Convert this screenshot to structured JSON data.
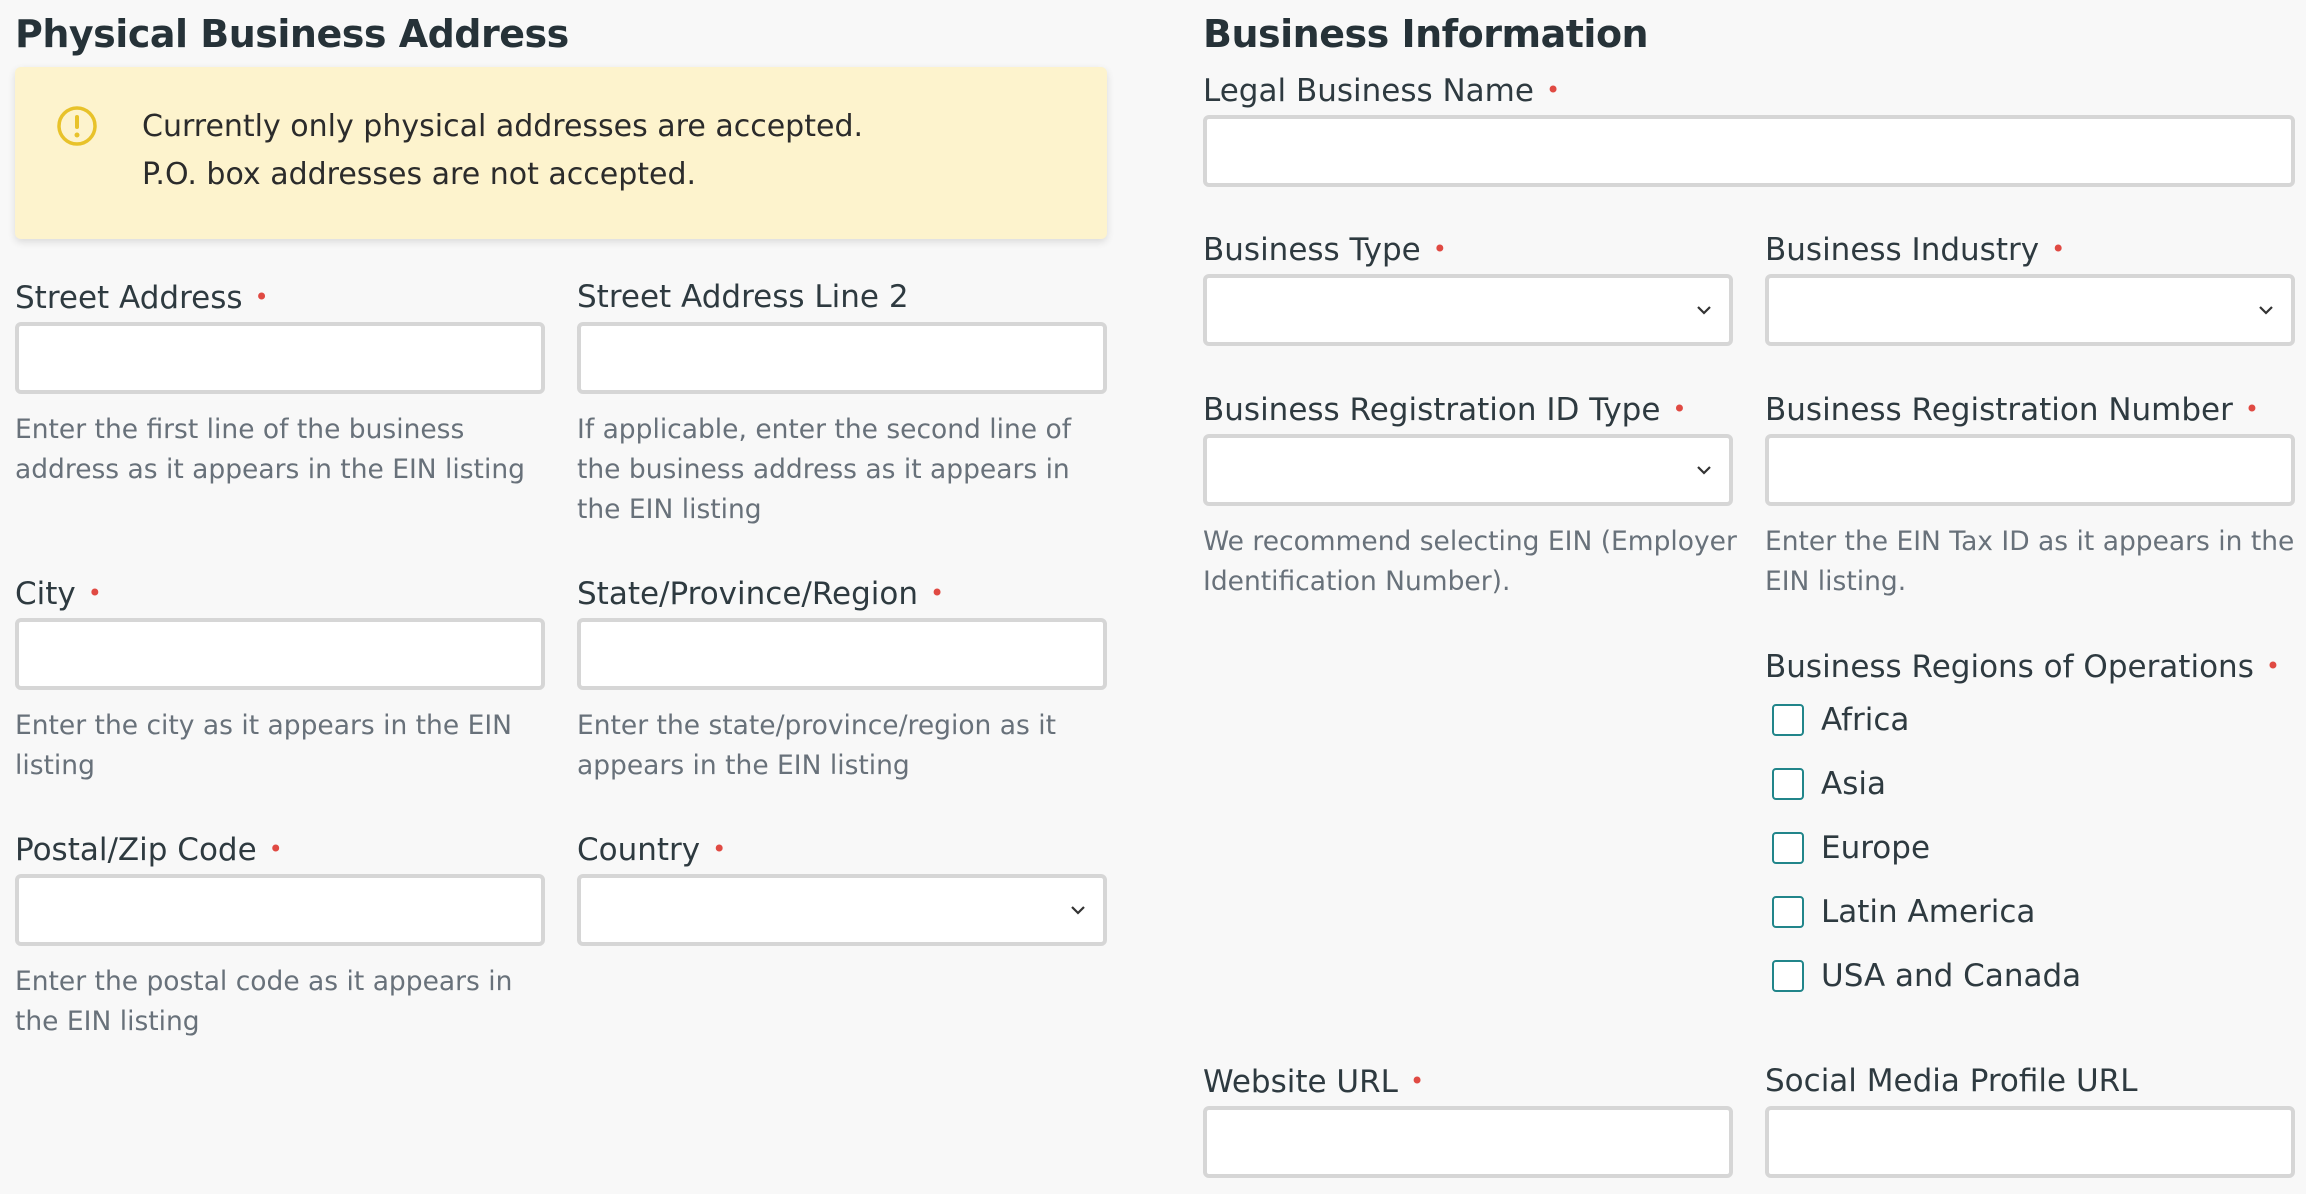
{
  "address": {
    "title": "Physical Business Address",
    "alert": {
      "icon": "exclamation-circle-icon",
      "line1": "Currently only physical addresses are accepted.",
      "line2": "P.O. box addresses are not accepted."
    },
    "street": {
      "label": "Street Address",
      "value": "",
      "help": "Enter the first line of the business address as it appears in the EIN listing"
    },
    "street2": {
      "label": "Street Address Line 2",
      "value": "",
      "help": "If applicable, enter the second line of the business address as it appears in the EIN listing"
    },
    "city": {
      "label": "City",
      "value": "",
      "help": "Enter the city as it appears in the EIN listing"
    },
    "state": {
      "label": "State/Province/Region",
      "value": "",
      "help": "Enter the state/province/region as it appears in the EIN listing"
    },
    "postal": {
      "label": "Postal/Zip Code",
      "value": "",
      "help": "Enter the postal code as it appears in the EIN listing"
    },
    "country": {
      "label": "Country",
      "value": ""
    }
  },
  "business": {
    "title": "Business Information",
    "legal_name": {
      "label": "Legal Business Name",
      "value": ""
    },
    "type": {
      "label": "Business Type",
      "value": ""
    },
    "industry": {
      "label": "Business Industry",
      "value": ""
    },
    "reg_id_type": {
      "label": "Business Registration ID Type",
      "value": "",
      "help": "We recommend selecting EIN (Employer Identification Number)."
    },
    "reg_number": {
      "label": "Business Registration Number",
      "value": "",
      "help": "Enter the EIN Tax ID as it appears in the EIN listing."
    },
    "regions": {
      "label": "Business Regions of Operations",
      "options": [
        {
          "label": "Africa",
          "checked": false
        },
        {
          "label": "Asia",
          "checked": false
        },
        {
          "label": "Europe",
          "checked": false
        },
        {
          "label": "Latin America",
          "checked": false
        },
        {
          "label": "USA and Canada",
          "checked": false
        }
      ]
    },
    "website": {
      "label": "Website URL",
      "value": ""
    },
    "social": {
      "label": "Social Media Profile URL",
      "value": ""
    }
  },
  "required_marker": "•",
  "colors": {
    "required": "#e04a43",
    "alert_bg": "#fdf3cd",
    "alert_icon": "#e8c22a",
    "checkbox_border": "#21858a"
  }
}
